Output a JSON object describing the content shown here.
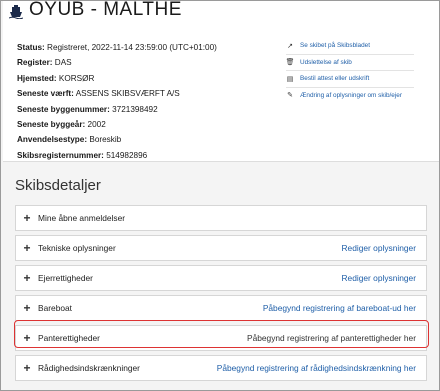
{
  "header": {
    "title": "OYUB - MALTHE",
    "icon": "ship-icon"
  },
  "details": [
    {
      "label": "Status:",
      "value": "Registreret, 2022-11-14 23:59:00 (UTC+01:00)"
    },
    {
      "label": "Register:",
      "value": "DAS"
    },
    {
      "label": "Hjemsted:",
      "value": "KORSØR"
    },
    {
      "label": "Seneste værft:",
      "value": "ASSENS SKIBSVÆRFT A/S"
    },
    {
      "label": "Seneste byggenummer:",
      "value": "3721398492"
    },
    {
      "label": "Seneste byggeår:",
      "value": "2002"
    },
    {
      "label": "Anvendelsestype:",
      "value": "Boreskib"
    },
    {
      "label": "Skibsregisternummer:",
      "value": "514982896"
    }
  ],
  "actions": [
    {
      "label": "Se skibet på Skibsbladet",
      "icon": "external-link-icon"
    },
    {
      "label": "Udslettelse af skib",
      "icon": "trash-icon"
    },
    {
      "label": "Bestil attest eller udskrift",
      "icon": "document-icon"
    },
    {
      "label": "Ændring af oplysninger om skib/ejer",
      "icon": "pencil-icon"
    }
  ],
  "section": {
    "title": "Skibsdetaljer"
  },
  "rows": [
    {
      "label": "Mine åbne anmeldelser",
      "link": ""
    },
    {
      "label": "Tekniske oplysninger",
      "link": "Rediger oplysninger"
    },
    {
      "label": "Ejerrettigheder",
      "link": "Rediger oplysninger"
    },
    {
      "label": "Bareboat",
      "link": "Påbegynd registrering af bareboat-ud her"
    },
    {
      "label": "Panterettigheder",
      "link": "Påbegynd registrering af panterettigheder her"
    },
    {
      "label": "Rådighedsindskrænkninger",
      "link": "Påbegynd registrering af rådighedsindskrænkning her"
    }
  ],
  "colors": {
    "link": "#1f5fa8",
    "highlight": "#dd3333"
  }
}
